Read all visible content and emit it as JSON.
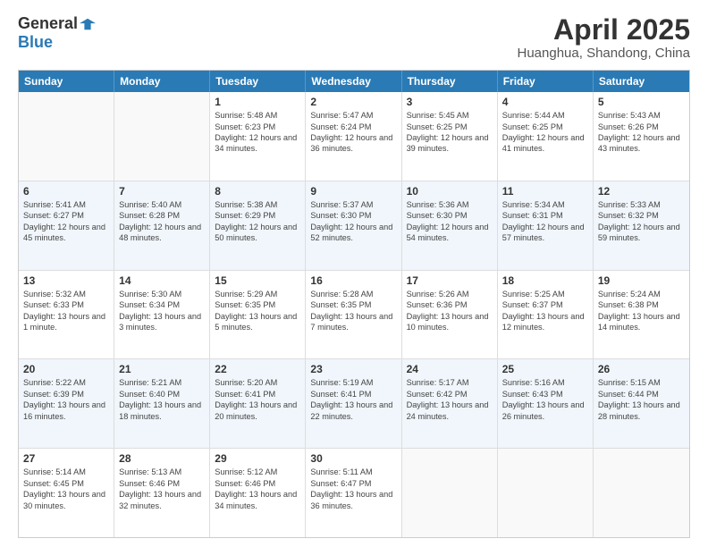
{
  "logo": {
    "general": "General",
    "blue": "Blue"
  },
  "title": "April 2025",
  "subtitle": "Huanghua, Shandong, China",
  "days": [
    "Sunday",
    "Monday",
    "Tuesday",
    "Wednesday",
    "Thursday",
    "Friday",
    "Saturday"
  ],
  "rows": [
    [
      {
        "day": "",
        "empty": true
      },
      {
        "day": "",
        "empty": true
      },
      {
        "day": "1",
        "sunrise": "Sunrise: 5:48 AM",
        "sunset": "Sunset: 6:23 PM",
        "daylight": "Daylight: 12 hours and 34 minutes."
      },
      {
        "day": "2",
        "sunrise": "Sunrise: 5:47 AM",
        "sunset": "Sunset: 6:24 PM",
        "daylight": "Daylight: 12 hours and 36 minutes."
      },
      {
        "day": "3",
        "sunrise": "Sunrise: 5:45 AM",
        "sunset": "Sunset: 6:25 PM",
        "daylight": "Daylight: 12 hours and 39 minutes."
      },
      {
        "day": "4",
        "sunrise": "Sunrise: 5:44 AM",
        "sunset": "Sunset: 6:25 PM",
        "daylight": "Daylight: 12 hours and 41 minutes."
      },
      {
        "day": "5",
        "sunrise": "Sunrise: 5:43 AM",
        "sunset": "Sunset: 6:26 PM",
        "daylight": "Daylight: 12 hours and 43 minutes."
      }
    ],
    [
      {
        "day": "6",
        "sunrise": "Sunrise: 5:41 AM",
        "sunset": "Sunset: 6:27 PM",
        "daylight": "Daylight: 12 hours and 45 minutes."
      },
      {
        "day": "7",
        "sunrise": "Sunrise: 5:40 AM",
        "sunset": "Sunset: 6:28 PM",
        "daylight": "Daylight: 12 hours and 48 minutes."
      },
      {
        "day": "8",
        "sunrise": "Sunrise: 5:38 AM",
        "sunset": "Sunset: 6:29 PM",
        "daylight": "Daylight: 12 hours and 50 minutes."
      },
      {
        "day": "9",
        "sunrise": "Sunrise: 5:37 AM",
        "sunset": "Sunset: 6:30 PM",
        "daylight": "Daylight: 12 hours and 52 minutes."
      },
      {
        "day": "10",
        "sunrise": "Sunrise: 5:36 AM",
        "sunset": "Sunset: 6:30 PM",
        "daylight": "Daylight: 12 hours and 54 minutes."
      },
      {
        "day": "11",
        "sunrise": "Sunrise: 5:34 AM",
        "sunset": "Sunset: 6:31 PM",
        "daylight": "Daylight: 12 hours and 57 minutes."
      },
      {
        "day": "12",
        "sunrise": "Sunrise: 5:33 AM",
        "sunset": "Sunset: 6:32 PM",
        "daylight": "Daylight: 12 hours and 59 minutes."
      }
    ],
    [
      {
        "day": "13",
        "sunrise": "Sunrise: 5:32 AM",
        "sunset": "Sunset: 6:33 PM",
        "daylight": "Daylight: 13 hours and 1 minute."
      },
      {
        "day": "14",
        "sunrise": "Sunrise: 5:30 AM",
        "sunset": "Sunset: 6:34 PM",
        "daylight": "Daylight: 13 hours and 3 minutes."
      },
      {
        "day": "15",
        "sunrise": "Sunrise: 5:29 AM",
        "sunset": "Sunset: 6:35 PM",
        "daylight": "Daylight: 13 hours and 5 minutes."
      },
      {
        "day": "16",
        "sunrise": "Sunrise: 5:28 AM",
        "sunset": "Sunset: 6:35 PM",
        "daylight": "Daylight: 13 hours and 7 minutes."
      },
      {
        "day": "17",
        "sunrise": "Sunrise: 5:26 AM",
        "sunset": "Sunset: 6:36 PM",
        "daylight": "Daylight: 13 hours and 10 minutes."
      },
      {
        "day": "18",
        "sunrise": "Sunrise: 5:25 AM",
        "sunset": "Sunset: 6:37 PM",
        "daylight": "Daylight: 13 hours and 12 minutes."
      },
      {
        "day": "19",
        "sunrise": "Sunrise: 5:24 AM",
        "sunset": "Sunset: 6:38 PM",
        "daylight": "Daylight: 13 hours and 14 minutes."
      }
    ],
    [
      {
        "day": "20",
        "sunrise": "Sunrise: 5:22 AM",
        "sunset": "Sunset: 6:39 PM",
        "daylight": "Daylight: 13 hours and 16 minutes."
      },
      {
        "day": "21",
        "sunrise": "Sunrise: 5:21 AM",
        "sunset": "Sunset: 6:40 PM",
        "daylight": "Daylight: 13 hours and 18 minutes."
      },
      {
        "day": "22",
        "sunrise": "Sunrise: 5:20 AM",
        "sunset": "Sunset: 6:41 PM",
        "daylight": "Daylight: 13 hours and 20 minutes."
      },
      {
        "day": "23",
        "sunrise": "Sunrise: 5:19 AM",
        "sunset": "Sunset: 6:41 PM",
        "daylight": "Daylight: 13 hours and 22 minutes."
      },
      {
        "day": "24",
        "sunrise": "Sunrise: 5:17 AM",
        "sunset": "Sunset: 6:42 PM",
        "daylight": "Daylight: 13 hours and 24 minutes."
      },
      {
        "day": "25",
        "sunrise": "Sunrise: 5:16 AM",
        "sunset": "Sunset: 6:43 PM",
        "daylight": "Daylight: 13 hours and 26 minutes."
      },
      {
        "day": "26",
        "sunrise": "Sunrise: 5:15 AM",
        "sunset": "Sunset: 6:44 PM",
        "daylight": "Daylight: 13 hours and 28 minutes."
      }
    ],
    [
      {
        "day": "27",
        "sunrise": "Sunrise: 5:14 AM",
        "sunset": "Sunset: 6:45 PM",
        "daylight": "Daylight: 13 hours and 30 minutes."
      },
      {
        "day": "28",
        "sunrise": "Sunrise: 5:13 AM",
        "sunset": "Sunset: 6:46 PM",
        "daylight": "Daylight: 13 hours and 32 minutes."
      },
      {
        "day": "29",
        "sunrise": "Sunrise: 5:12 AM",
        "sunset": "Sunset: 6:46 PM",
        "daylight": "Daylight: 13 hours and 34 minutes."
      },
      {
        "day": "30",
        "sunrise": "Sunrise: 5:11 AM",
        "sunset": "Sunset: 6:47 PM",
        "daylight": "Daylight: 13 hours and 36 minutes."
      },
      {
        "day": "",
        "empty": true
      },
      {
        "day": "",
        "empty": true
      },
      {
        "day": "",
        "empty": true
      }
    ]
  ]
}
